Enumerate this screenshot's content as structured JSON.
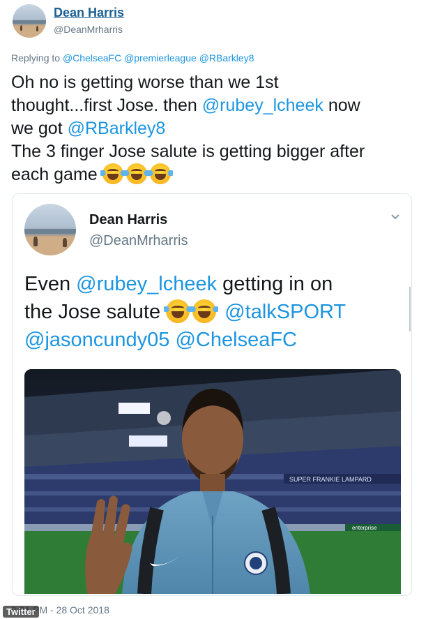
{
  "author": {
    "name": "Dean Harris",
    "handle": "@DeanMrharris"
  },
  "reply": {
    "prefix": "Replying to",
    "mentions": [
      "@ChelseaFC",
      "@premierleague",
      "@RBarkley8"
    ]
  },
  "tweet": {
    "line1": "Oh no is getting worse than we 1st",
    "line2_a": "thought...first Jose. then ",
    "line2_mention": "@rubey_lcheek",
    "line2_b": " now",
    "line3_a": "we got ",
    "line3_mention": "@RBarkley8",
    "line4": "The 3 finger Jose salute is getting bigger after",
    "line5": "each game",
    "emoji_count": 3,
    "emoji": "face-with-tears-of-joy-icon"
  },
  "quoted": {
    "name": "Dean Harris",
    "handle": "@DeanMrharris",
    "text_a": "Even ",
    "mention1": "@rubey_lcheek",
    "text_b": " getting in on",
    "text_c": "the Jose salute ",
    "mention2": "@talkSPORT",
    "mention3": "@jasoncundy05",
    "mention4": "@ChelseaFC",
    "emoji_count": 2,
    "photo_banner": "SUPER FRANKIE LAMPARD",
    "photo_board": "enterprise"
  },
  "footer": {
    "timestamp": "9:01 PM - 28 Oct 2018",
    "watermark": "Twitter"
  },
  "colors": {
    "link": "#1b95e0",
    "name_link": "#1b5f93",
    "secondary": "#657786",
    "text": "#14171a",
    "card_border": "#e1e8ed"
  }
}
